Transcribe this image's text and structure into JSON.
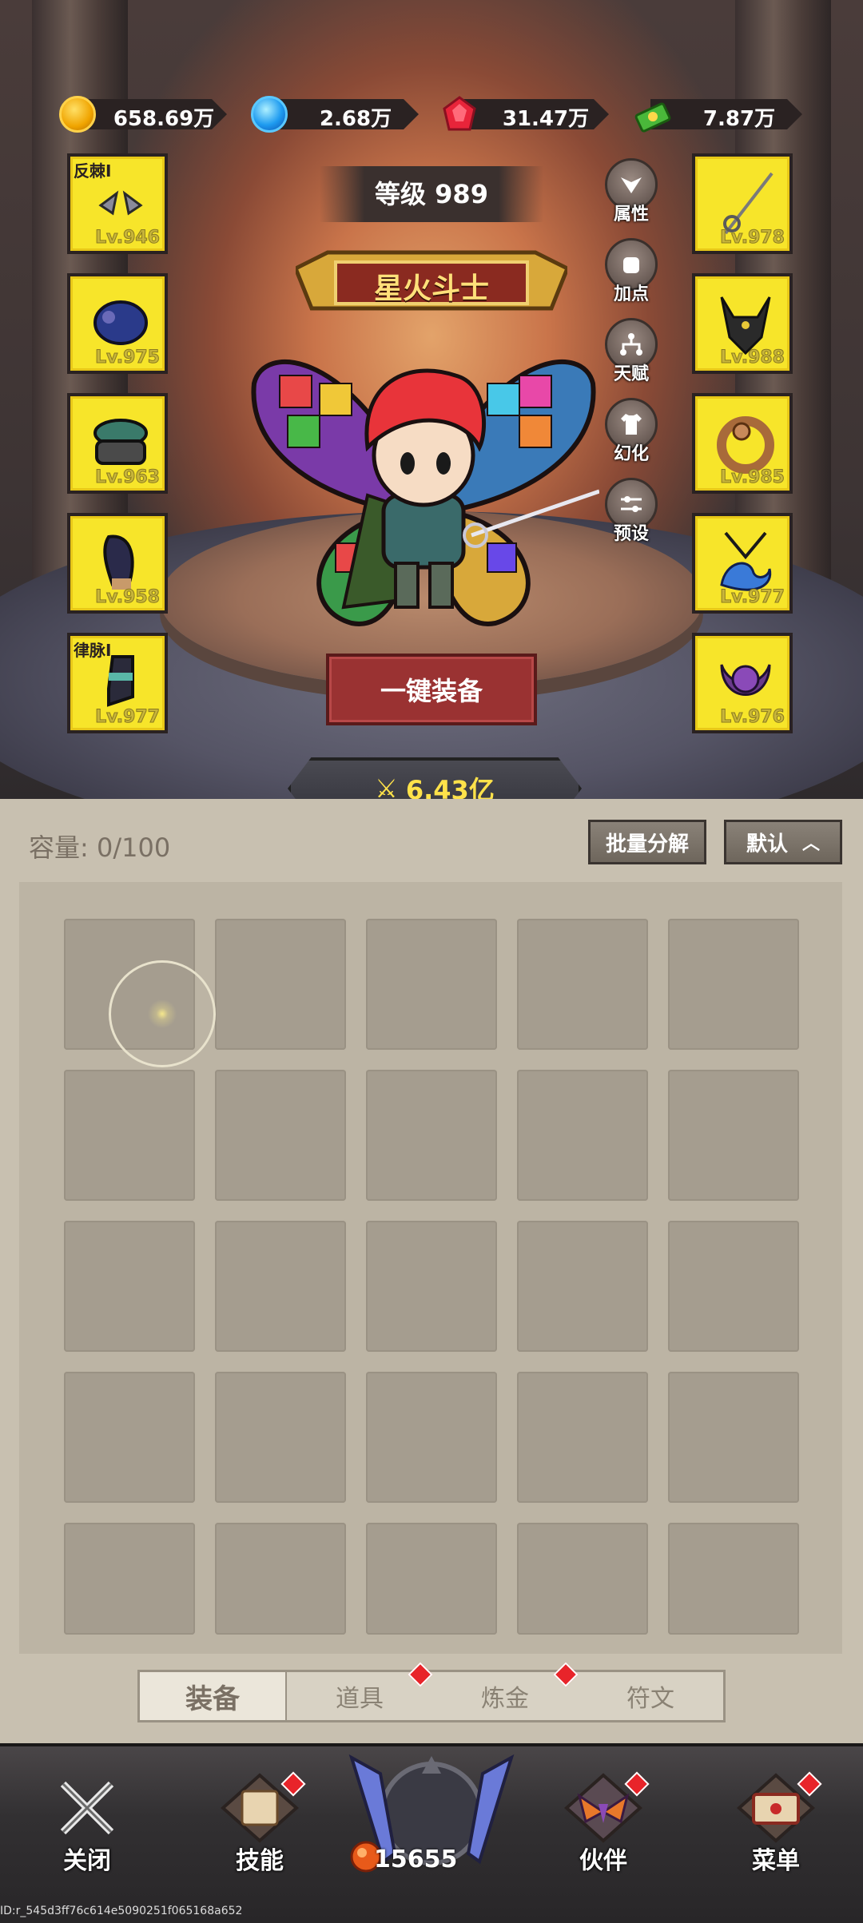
{
  "currencies": [
    {
      "icon": "gold-coin-icon",
      "value": "658.69万"
    },
    {
      "icon": "blue-orb-icon",
      "value": "2.68万"
    },
    {
      "icon": "ruby-gem-icon",
      "value": "31.47万"
    },
    {
      "icon": "cash-stack-icon",
      "value": "7.87万"
    }
  ],
  "level_label": "等级 989",
  "title_badge": "星火斗士",
  "left_slots": [
    {
      "tag": "反棘I",
      "level": "Lv.946",
      "icon": "wings-icon"
    },
    {
      "tag": "",
      "level": "Lv.975",
      "icon": "helmet-icon"
    },
    {
      "tag": "",
      "level": "Lv.963",
      "icon": "shoulder-armor-icon"
    },
    {
      "tag": "",
      "level": "Lv.958",
      "icon": "glove-icon"
    },
    {
      "tag": "律脉I",
      "level": "Lv.977",
      "icon": "boot-icon"
    }
  ],
  "right_slots": [
    {
      "level": "Lv.978",
      "icon": "rapier-icon"
    },
    {
      "level": "Lv.988",
      "icon": "horned-mask-icon"
    },
    {
      "level": "Lv.985",
      "icon": "ring-icon"
    },
    {
      "level": "Lv.977",
      "icon": "wave-amulet-icon"
    },
    {
      "level": "Lv.976",
      "icon": "purple-orb-emblem-icon"
    }
  ],
  "side_buttons": [
    "属性",
    "加点",
    "天赋",
    "幻化",
    "预设"
  ],
  "equip_all_label": "一键装备",
  "power_value": "6.43亿",
  "capacity_label": "容量: 0/100",
  "batch_decompose_label": "批量分解",
  "sort_label": "默认",
  "tabs": [
    {
      "label": "装备",
      "active": true,
      "dot": false
    },
    {
      "label": "道具",
      "active": false,
      "dot": true
    },
    {
      "label": "炼金",
      "active": false,
      "dot": true
    },
    {
      "label": "符文",
      "active": false,
      "dot": false
    }
  ],
  "nav": {
    "close": "关闭",
    "skills": "技能",
    "center_value": "15655",
    "partner": "伙伴",
    "menu": "菜单"
  },
  "footer_id": "ID:r_545d3ff76c614e5090251f065168a652",
  "colors": {
    "slot_yellow": "#f7e52a",
    "equip_button_red": "#9a3232",
    "power_gold": "#ffe24a",
    "notify_red": "#e8242a"
  }
}
